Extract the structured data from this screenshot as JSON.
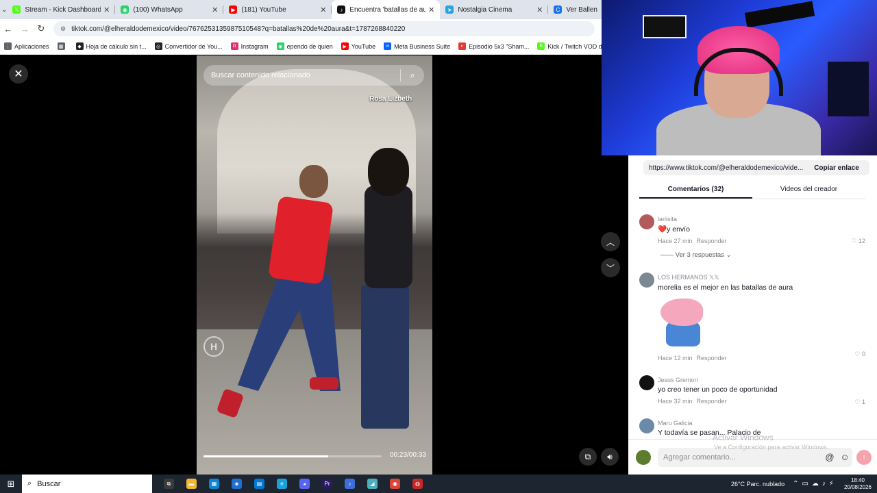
{
  "browser": {
    "tabs": [
      {
        "label": "Stream - Kick Dashboard",
        "color": "#53fc18",
        "glyph": "K",
        "active": false
      },
      {
        "label": "(100) WhatsApp",
        "color": "#25d366",
        "glyph": "◉",
        "active": false
      },
      {
        "label": "(181) YouTube",
        "color": "#ff0000",
        "glyph": "▶",
        "active": false
      },
      {
        "label": "Encuentra 'batallas de aura'",
        "color": "#111111",
        "glyph": "♪",
        "active": true
      },
      {
        "label": "Nostalgia Cinema",
        "color": "#2aa3e0",
        "glyph": "➤",
        "active": false
      },
      {
        "label": "Ver Ballen",
        "color": "#1a73e8",
        "glyph": "C",
        "active": false
      }
    ],
    "address": "tiktok.com/@elheraldodemexico/video/7676253135987510548?q=batallas%20de%20aura&t=1787268840220",
    "bookmarks": [
      {
        "label": "Aplicaciones",
        "color": "#5f6368",
        "glyph": "⋮"
      },
      {
        "label": "",
        "color": "#5f6368",
        "glyph": "▦"
      },
      {
        "label": "Hoja de cálculo sin t...",
        "color": "#222222",
        "glyph": "◆"
      },
      {
        "label": "Convertidor de You...",
        "color": "#222222",
        "glyph": "◎"
      },
      {
        "label": "Instagram",
        "color": "#e1306c",
        "glyph": "◘"
      },
      {
        "label": "ependo de quien",
        "color": "#25d366",
        "glyph": "◉"
      },
      {
        "label": "YouTube",
        "color": "#ff0000",
        "glyph": "▶"
      },
      {
        "label": "Meta Business Suite",
        "color": "#0866ff",
        "glyph": "∞"
      },
      {
        "label": "Episodio 5x3 \"Sham...",
        "color": "#e53935",
        "glyph": "◐"
      },
      {
        "label": "Kick / Twitch VOD d...",
        "color": "#53fc18",
        "glyph": "K"
      }
    ]
  },
  "video": {
    "search_placeholder": "Buscar contenido relacionado",
    "author_watermark": "Rosa Lizbeth",
    "logo_letter": "H",
    "time": "00:23/00:33",
    "progress": 0.7
  },
  "panel": {
    "link": "https://www.tiktok.com/@elheraldodemexico/vide...",
    "copy_label": "Copiar enlace",
    "tabs": [
      "Comentarios (32)",
      "Videos del creador"
    ],
    "comments": [
      {
        "user": "lariisita",
        "text": "❤️y envío",
        "time": "Hace 27 min",
        "reply": "Responder",
        "likes": "12",
        "avatar": "#b35a5a",
        "replies": "Ver 3 respuestas ⌄",
        "sticker": false
      },
      {
        "user": "LOS HERMANOS 𝕏𝕏",
        "text": "morelia es el mejor en las batallas de aura",
        "time": "Hace 12 min",
        "reply": "Responder",
        "likes": "0",
        "avatar": "#7b8a92",
        "replies": "",
        "sticker": true
      },
      {
        "user": "Jesus Gremori",
        "text": "yo creo tener un poco de oportunidad",
        "time": "Hace 32 min",
        "reply": "Responder",
        "likes": "1",
        "avatar": "#111111",
        "replies": "",
        "sticker": false
      },
      {
        "user": "Maru Galicia",
        "text": "Y todavía se pasan... Palacio de",
        "time": "",
        "reply": "",
        "likes": "",
        "avatar": "#6a8aa8",
        "replies": "",
        "sticker": false
      }
    ],
    "comment_placeholder": "Agregar comentario...",
    "windows_notice": "Activar Windows",
    "windows_notice_sub": "Ve a Configuración para activar Windows."
  },
  "taskbar": {
    "search_label": "Buscar",
    "apps": [
      {
        "color": "#3b3b3b",
        "glyph": "⧉"
      },
      {
        "color": "#f2b632",
        "glyph": "▬"
      },
      {
        "color": "#0a84d8",
        "glyph": "▦"
      },
      {
        "color": "#1f6fd0",
        "glyph": "◈"
      },
      {
        "color": "#0078d4",
        "glyph": "▤"
      },
      {
        "color": "#1aa1d9",
        "glyph": "e"
      },
      {
        "color": "#5865f2",
        "glyph": "◕"
      },
      {
        "color": "#2a1a5e",
        "glyph": "Pr"
      },
      {
        "color": "#3d6fd8",
        "glyph": "♪"
      },
      {
        "color": "#4ab0c0",
        "glyph": "◢"
      },
      {
        "color": "#db4437",
        "glyph": "◉"
      },
      {
        "color": "#c62828",
        "glyph": "◍"
      }
    ],
    "weather": "26°C  Parc. nublado",
    "time": "18:40",
    "date": "20/08/2026"
  }
}
